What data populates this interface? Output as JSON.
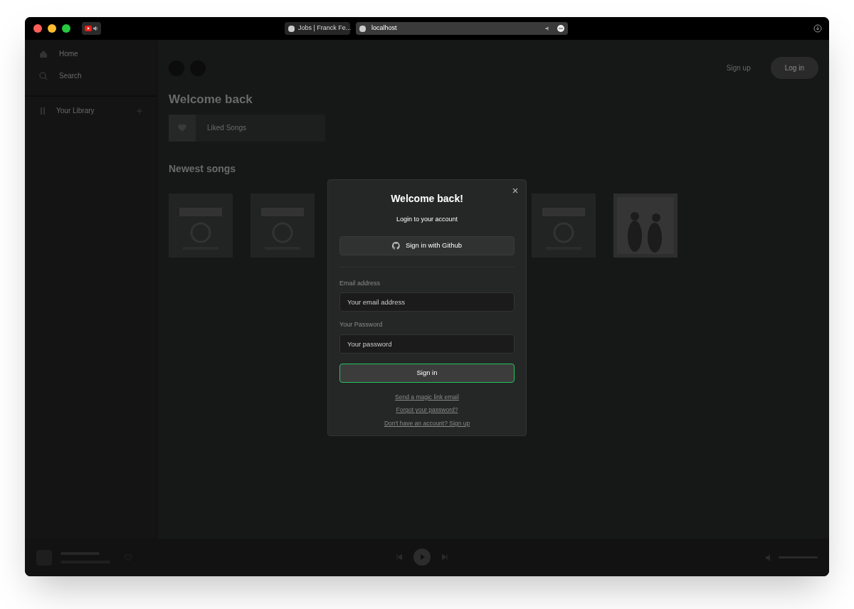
{
  "browser": {
    "tabs": [
      {
        "title": "Jobs | Franck Fe...",
        "selected": false
      },
      {
        "title": "localhost",
        "selected": true
      }
    ]
  },
  "sidebar": {
    "items": [
      {
        "label": "Home",
        "kind": "home"
      },
      {
        "label": "Search",
        "kind": "search"
      }
    ],
    "library": {
      "label": "Your Library"
    }
  },
  "header": {
    "sign_up": "Sign up",
    "log_in": "Log in"
  },
  "main": {
    "greeting": "Welcome back",
    "shortcut": "Liked Songs",
    "section_title": "Newest songs"
  },
  "player": {
    "volume": {
      "level": 1
    }
  },
  "modal": {
    "title": "Welcome back!",
    "subtitle": "Login to your account",
    "github_button": "Sign in with Github",
    "email_label": "Email address",
    "email_placeholder": "Your email address",
    "password_label": "Your Password",
    "password_placeholder": "Your password",
    "submit": "Sign in",
    "links": [
      "Send a magic link email",
      "Forgot your password?",
      "Don't have an account? Sign up"
    ]
  }
}
